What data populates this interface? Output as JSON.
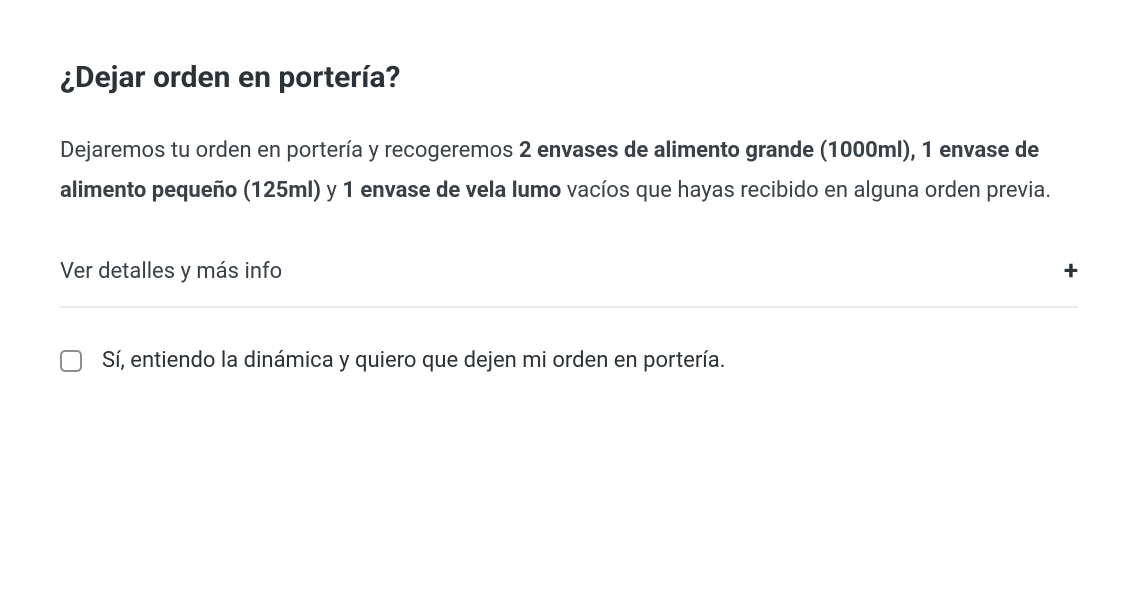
{
  "heading": "¿Dejar orden en portería?",
  "description": {
    "part1": "Dejaremos tu orden en portería y recogeremos ",
    "bold1": "2 envases de alimento grande (1000ml), 1 envase de alimento pequeño (125ml)",
    "part2": " y ",
    "bold2": "1 envase de vela lumo",
    "part3": " vacíos que hayas recibido en alguna orden previa."
  },
  "expand": {
    "label": "Ver detalles y más info",
    "icon": "+"
  },
  "checkbox": {
    "label": "Sí, entiendo la dinámica y quiero que dejen mi orden en portería.",
    "checked": false
  }
}
